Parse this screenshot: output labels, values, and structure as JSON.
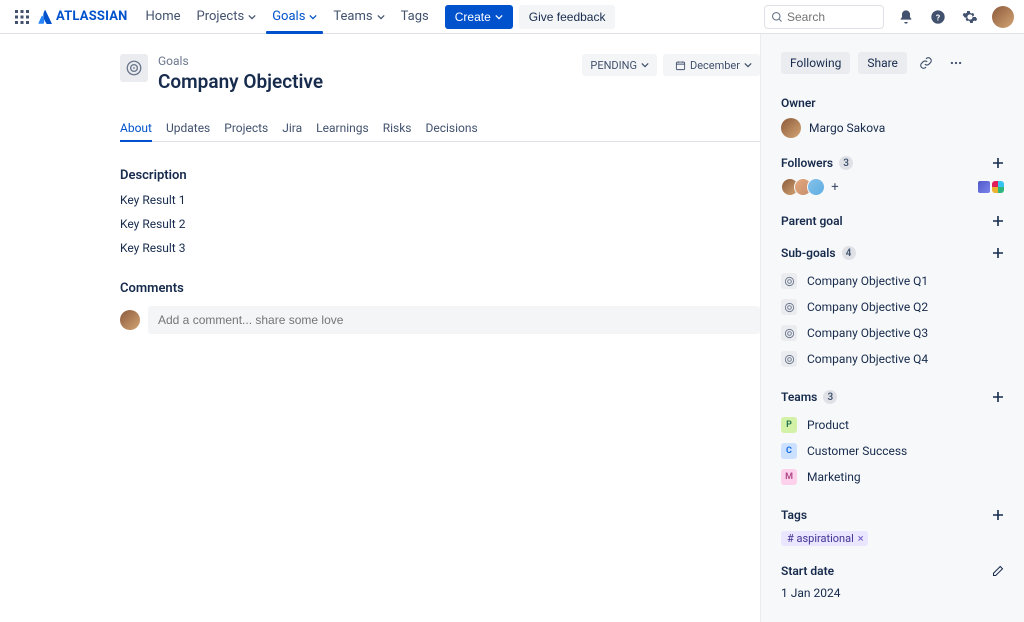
{
  "brand": "ATLASSIAN",
  "nav": {
    "home": "Home",
    "projects": "Projects",
    "goals": "Goals",
    "teams": "Teams",
    "tags": "Tags",
    "create": "Create",
    "feedback": "Give feedback"
  },
  "search": {
    "placeholder": "Search"
  },
  "page": {
    "breadcrumb": "Goals",
    "title": "Company Objective",
    "status": "PENDING",
    "due": "December"
  },
  "tabs": {
    "about": "About",
    "updates": "Updates",
    "projects": "Projects",
    "jira": "Jira",
    "learnings": "Learnings",
    "risks": "Risks",
    "decisions": "Decisions"
  },
  "description": {
    "heading": "Description",
    "items": [
      "Key Result 1",
      "Key Result 2",
      "Key Result 3"
    ]
  },
  "comments": {
    "heading": "Comments",
    "placeholder": "Add a comment... share some love"
  },
  "sidebar": {
    "following": "Following",
    "share": "Share",
    "owner_label": "Owner",
    "owner_name": "Margo Sakova",
    "followers_label": "Followers",
    "followers_count": "3",
    "parent_label": "Parent goal",
    "subgoals_label": "Sub-goals",
    "subgoals_count": "4",
    "subgoals": [
      "Company Objective Q1",
      "Company Objective Q2",
      "Company Objective Q3",
      "Company Objective Q4"
    ],
    "teams_label": "Teams",
    "teams_count": "3",
    "teams": [
      {
        "initial": "P",
        "name": "Product",
        "bg": "#D3F1A7",
        "fg": "#216E4E"
      },
      {
        "initial": "C",
        "name": "Customer Success",
        "bg": "#CCE0FF",
        "fg": "#0C66E4"
      },
      {
        "initial": "M",
        "name": "Marketing",
        "bg": "#FDD0EC",
        "fg": "#AE4787"
      }
    ],
    "tags_label": "Tags",
    "tag_name": "# aspirational",
    "start_label": "Start date",
    "start_value": "1 Jan 2024"
  }
}
